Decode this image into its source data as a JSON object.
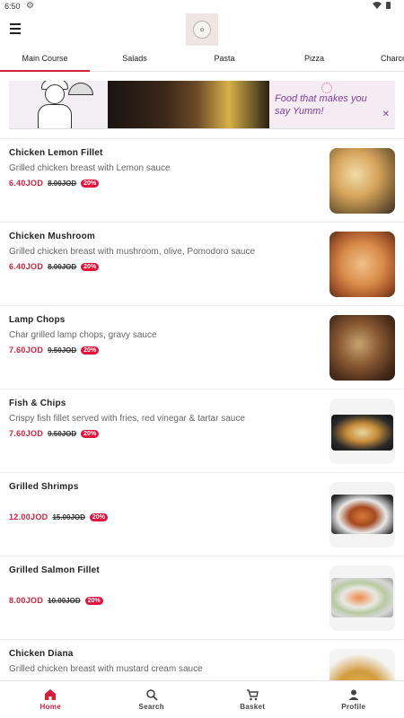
{
  "status_bar": {
    "time": "6:50"
  },
  "tabs": [
    {
      "label": "Main Course",
      "active": true
    },
    {
      "label": "Salads"
    },
    {
      "label": "Pasta"
    },
    {
      "label": "Pizza"
    },
    {
      "label": "Charco"
    }
  ],
  "banner": {
    "text_line1": "Food that makes you",
    "text_line2": "say Yumm!"
  },
  "menu_items": [
    {
      "name": "Chicken Lemon Fillet",
      "description": "Grilled chicken breast with Lemon sauce",
      "price": "6.40JOD",
      "old_price": "8.00JOD",
      "discount": "20%"
    },
    {
      "name": "Chicken Mushroom",
      "description": "Grilled chicken breast with mushroom, olive, Pomodoro sauce",
      "price": "6.40JOD",
      "old_price": "8.00JOD",
      "discount": "20%"
    },
    {
      "name": "Lamp Chops",
      "description": "Char grilled lamp chops, gravy sauce",
      "price": "7.60JOD",
      "old_price": "9.50JOD",
      "discount": "20%"
    },
    {
      "name": "Fish & Chips",
      "description": "Crispy fish fillet served with fries, red vinegar & tartar sauce",
      "price": "7.60JOD",
      "old_price": "9.50JOD",
      "discount": "20%"
    },
    {
      "name": "Grilled Shrimps",
      "description": "",
      "price": "12.00JOD",
      "old_price": "15.00JOD",
      "discount": "20%"
    },
    {
      "name": "Grilled Salmon Fillet",
      "description": "",
      "price": "8.00JOD",
      "old_price": "10.00JOD",
      "discount": "20%"
    },
    {
      "name": "Chicken Diana",
      "description": "Grilled chicken breast with mustard cream sauce",
      "price": "",
      "old_price": "",
      "discount": ""
    }
  ],
  "bottom_nav": [
    {
      "label": "Home",
      "icon": "home-icon",
      "active": true
    },
    {
      "label": "Search",
      "icon": "search-icon"
    },
    {
      "label": "Basket",
      "icon": "cart-icon"
    },
    {
      "label": "Profile",
      "icon": "profile-icon"
    }
  ],
  "colors": {
    "accent": "#d3213c",
    "discount_bg": "#e5123c"
  }
}
